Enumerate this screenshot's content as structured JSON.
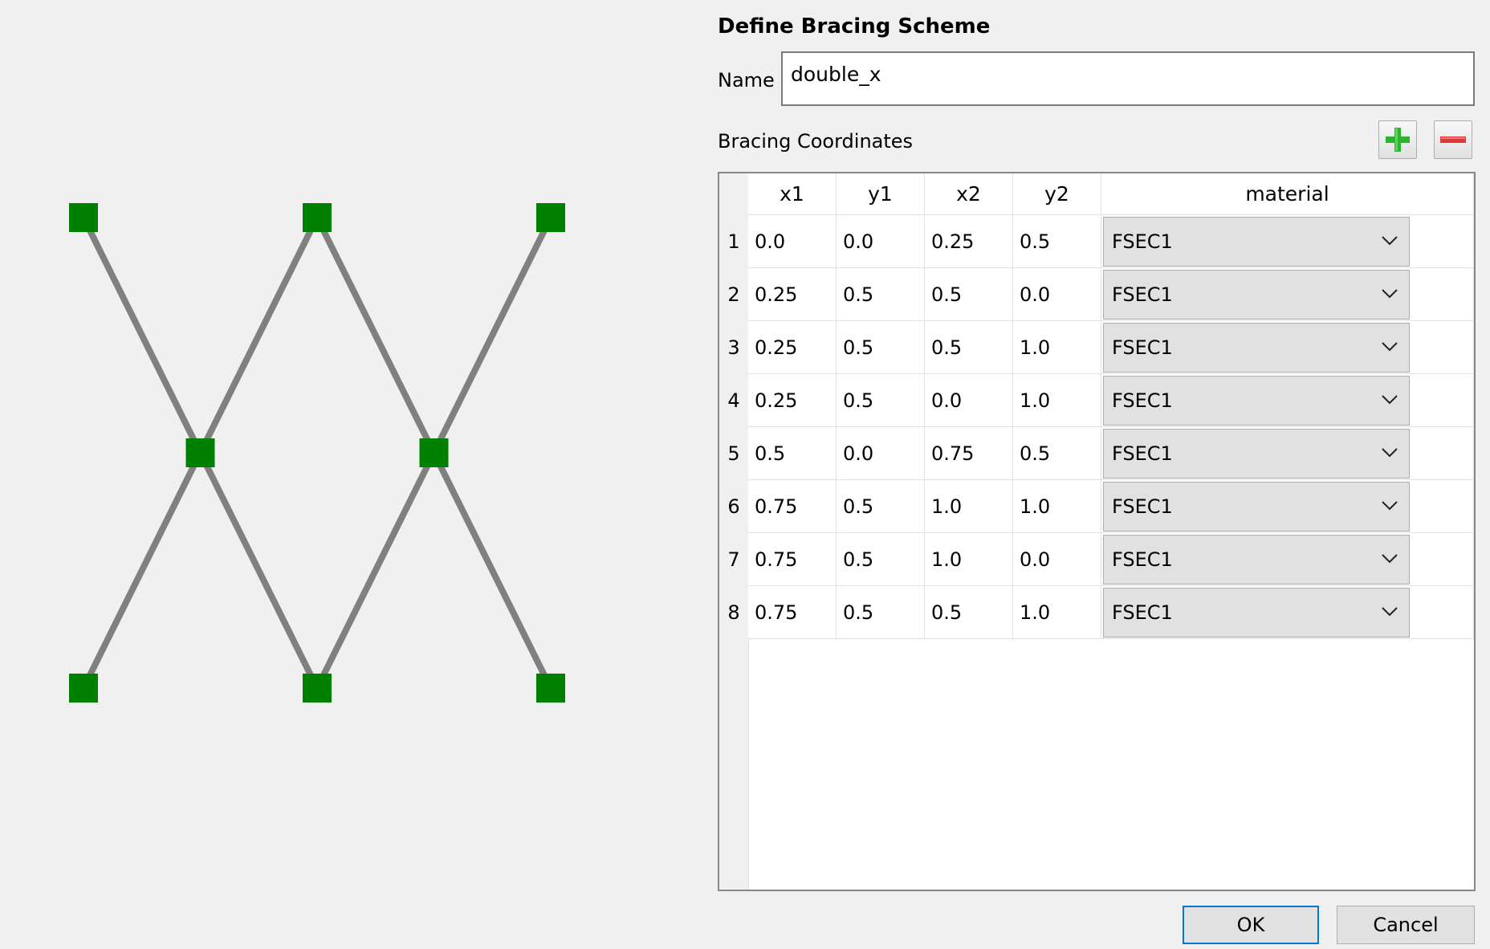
{
  "dialog": {
    "title": "Define Bracing Scheme",
    "name_label": "Name",
    "name_value": "double_x",
    "coords_label": "Bracing Coordinates",
    "add_icon": "plus-icon",
    "remove_icon": "minus-icon",
    "ok_label": "OK",
    "cancel_label": "Cancel"
  },
  "table": {
    "columns": [
      "x1",
      "y1",
      "x2",
      "y2",
      "material"
    ],
    "rows": [
      {
        "num": "1",
        "x1": "0.0",
        "y1": "0.0",
        "x2": "0.25",
        "y2": "0.5",
        "material": "FSEC1"
      },
      {
        "num": "2",
        "x1": "0.25",
        "y1": "0.5",
        "x2": "0.5",
        "y2": "0.0",
        "material": "FSEC1"
      },
      {
        "num": "3",
        "x1": "0.25",
        "y1": "0.5",
        "x2": "0.5",
        "y2": "1.0",
        "material": "FSEC1"
      },
      {
        "num": "4",
        "x1": "0.25",
        "y1": "0.5",
        "x2": "0.0",
        "y2": "1.0",
        "material": "FSEC1"
      },
      {
        "num": "5",
        "x1": "0.5",
        "y1": "0.0",
        "x2": "0.75",
        "y2": "0.5",
        "material": "FSEC1"
      },
      {
        "num": "6",
        "x1": "0.75",
        "y1": "0.5",
        "x2": "1.0",
        "y2": "1.0",
        "material": "FSEC1"
      },
      {
        "num": "7",
        "x1": "0.75",
        "y1": "0.5",
        "x2": "1.0",
        "y2": "0.0",
        "material": "FSEC1"
      },
      {
        "num": "8",
        "x1": "0.75",
        "y1": "0.5",
        "x2": "0.5",
        "y2": "1.0",
        "material": "FSEC1"
      }
    ]
  },
  "preview": {
    "line_color": "#808080",
    "node_color": "#008000",
    "segments": [
      [
        0.0,
        0.0,
        0.25,
        0.5
      ],
      [
        0.25,
        0.5,
        0.5,
        0.0
      ],
      [
        0.25,
        0.5,
        0.5,
        1.0
      ],
      [
        0.25,
        0.5,
        0.0,
        1.0
      ],
      [
        0.5,
        0.0,
        0.75,
        0.5
      ],
      [
        0.75,
        0.5,
        1.0,
        1.0
      ],
      [
        0.75,
        0.5,
        1.0,
        0.0
      ],
      [
        0.75,
        0.5,
        0.5,
        1.0
      ]
    ]
  },
  "colors": {
    "ok_focus": "#0078d7",
    "add_green": "#2bb52b",
    "remove_red": "#e03a3a"
  }
}
